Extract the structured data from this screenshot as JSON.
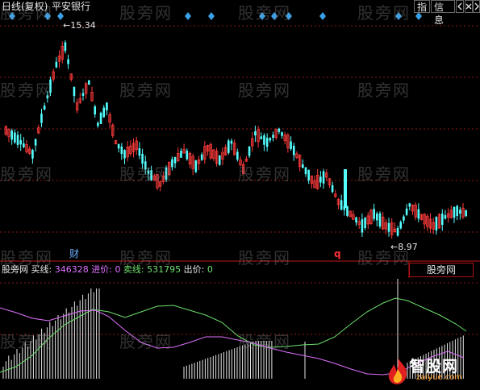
{
  "header": {
    "period_label": "日线(复权)",
    "stock_name": "平安银行",
    "btn_index": "指",
    "btn_info": "信息",
    "btn_prev_icon": "chevron-left-icon",
    "btn_next_icon": "chevron-right-icon",
    "btn_close_icon": "close-icon"
  },
  "main_chart": {
    "high_label": "15.34",
    "low_label": "8.97",
    "marker_cai": "财",
    "marker_q": "q",
    "high_value": 15.34,
    "low_value": 8.97,
    "y_range": [
      8.4,
      15.9
    ]
  },
  "watermark": {
    "text": "股旁网"
  },
  "indicator": {
    "name": "股旁网",
    "buy_label": "买线:",
    "buy_value": "346328",
    "in_price_label": "进价:",
    "in_price_value": "0",
    "sell_label": "卖线:",
    "sell_value": "531795",
    "out_price_label": "出价:",
    "out_price_value": "0",
    "panel_button": "股旁网"
  },
  "footer_logo": {
    "text": "智股网",
    "sub": "zaiyue.com"
  },
  "colors": {
    "bg": "#000000",
    "grid": "#8b1a1a",
    "up": "#ff3b3b",
    "down": "#54ffff",
    "diamond": "#3aa0e8",
    "buy_line": "#e070ff",
    "sell_line": "#6ee06e",
    "text_white": "#e6e6e6",
    "marker_q": "#ff3030"
  }
}
